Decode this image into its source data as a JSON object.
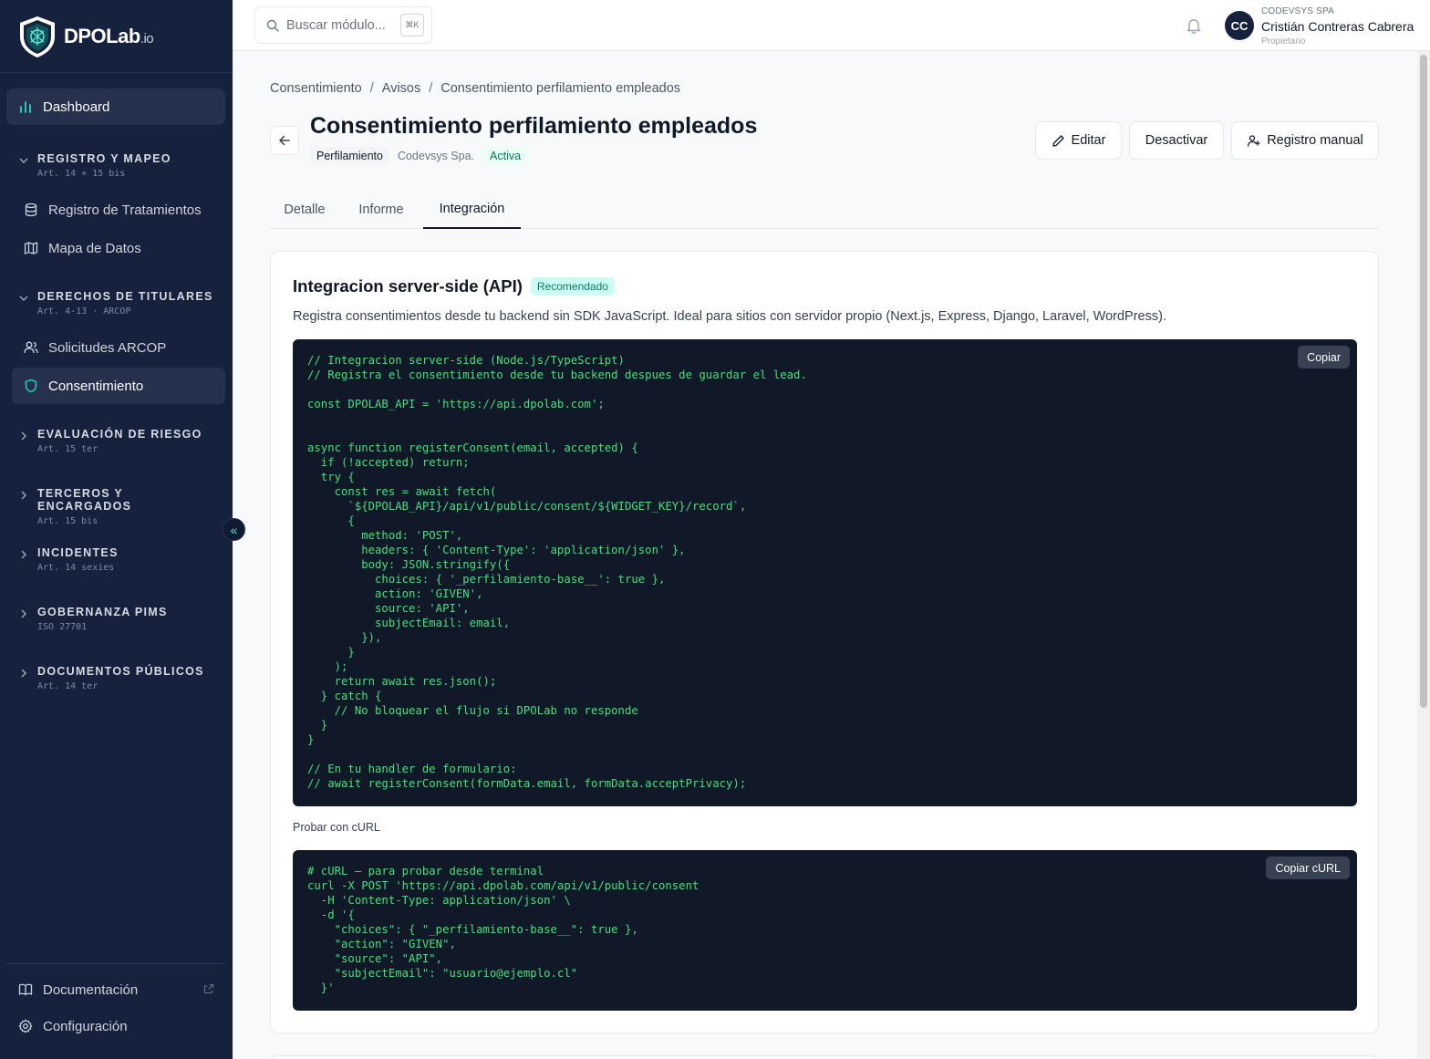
{
  "brand": {
    "name": "DPOLab",
    "suffix": ".io"
  },
  "sidebar": {
    "dashboard": "Dashboard",
    "sections": [
      {
        "title": "REGISTRO Y MAPEO",
        "sub": "Art. 14 + 15 bis"
      },
      {
        "title": "DERECHOS DE TITULARES",
        "sub": "Art. 4-13 · ARCOP"
      },
      {
        "title": "EVALUACIÓN DE RIESGO",
        "sub": "Art. 15 ter"
      },
      {
        "title": "TERCEROS Y ENCARGADOS",
        "sub": "Art. 15 bis"
      },
      {
        "title": "INCIDENTES",
        "sub": "Art. 14 sexies"
      },
      {
        "title": "GOBERNANZA PIMS",
        "sub": "ISO 27701"
      },
      {
        "title": "DOCUMENTOS PÚBLICOS",
        "sub": "Art. 14 ter"
      }
    ],
    "items": {
      "registro": "Registro de Tratamientos",
      "mapa": "Mapa de Datos",
      "solicitudes": "Solicitudes ARCOP",
      "consentimiento": "Consentimiento"
    },
    "footer": {
      "docs": "Documentación",
      "config": "Configuración"
    },
    "collapse_glyph": "«"
  },
  "topbar": {
    "search_placeholder": "Buscar módulo...",
    "shortcut": "⌘K",
    "user": {
      "initials": "CC",
      "org": "CODEVSYS SPA",
      "name": "Cristián Contreras Cabrera",
      "role": "Propietario"
    }
  },
  "breadcrumb": [
    "Consentimiento",
    "Avisos",
    "Consentimiento perfilamiento empleados"
  ],
  "page": {
    "title": "Consentimiento perfilamiento empleados",
    "tag": "Perfilamiento",
    "company": "Codevsys Spa.",
    "status": "Activa",
    "actions": {
      "edit": "Editar",
      "deactivate": "Desactivar",
      "manual": "Registro manual"
    }
  },
  "tabs": [
    "Detalle",
    "Informe",
    "Integración"
  ],
  "integration": {
    "title": "Integracion server-side (API)",
    "badge": "Recomendado",
    "description": "Registra consentimientos desde tu backend sin SDK JavaScript. Ideal para sitios con servidor propio (Next.js, Express, Django, Laravel, WordPress).",
    "copy_label": "Copiar",
    "code": "// Integracion server-side (Node.js/TypeScript)\n// Registra el consentimiento desde tu backend despues de guardar el lead.\n\nconst DPOLAB_API = 'https://api.dpolab.com';\n\n\nasync function registerConsent(email, accepted) {\n  if (!accepted) return;\n  try {\n    const res = await fetch(\n      `${DPOLAB_API}/api/v1/public/consent/${WIDGET_KEY}/record`,\n      {\n        method: 'POST',\n        headers: { 'Content-Type': 'application/json' },\n        body: JSON.stringify({\n          choices: { '_perfilamiento-base__': true },\n          action: 'GIVEN',\n          source: 'API',\n          subjectEmail: email,\n        }),\n      }\n    );\n    return await res.json();\n  } catch {\n    // No bloquear el flujo si DPOLab no responde\n  }\n}\n\n// En tu handler de formulario:\n// await registerConsent(formData.email, formData.acceptPrivacy);",
    "curl_label": "Probar con cURL",
    "curl_copy_label": "Copiar cURL",
    "curl_code": "# cURL — para probar desde terminal\ncurl -X POST 'https://api.dpolab.com/api/v1/public/consent\n  -H 'Content-Type: application/json' \\\n  -d '{\n    \"choices\": { \"_perfilamiento-base__\": true },\n    \"action\": \"GIVEN\",\n    \"source\": \"API\",\n    \"subjectEmail\": \"usuario@ejemplo.cl\"\n  }'"
  },
  "colors": {
    "sidebar_bg": "#15213d",
    "accent": "#2dd4bf",
    "code_bg": "#111827",
    "code_text": "#4ade80"
  }
}
